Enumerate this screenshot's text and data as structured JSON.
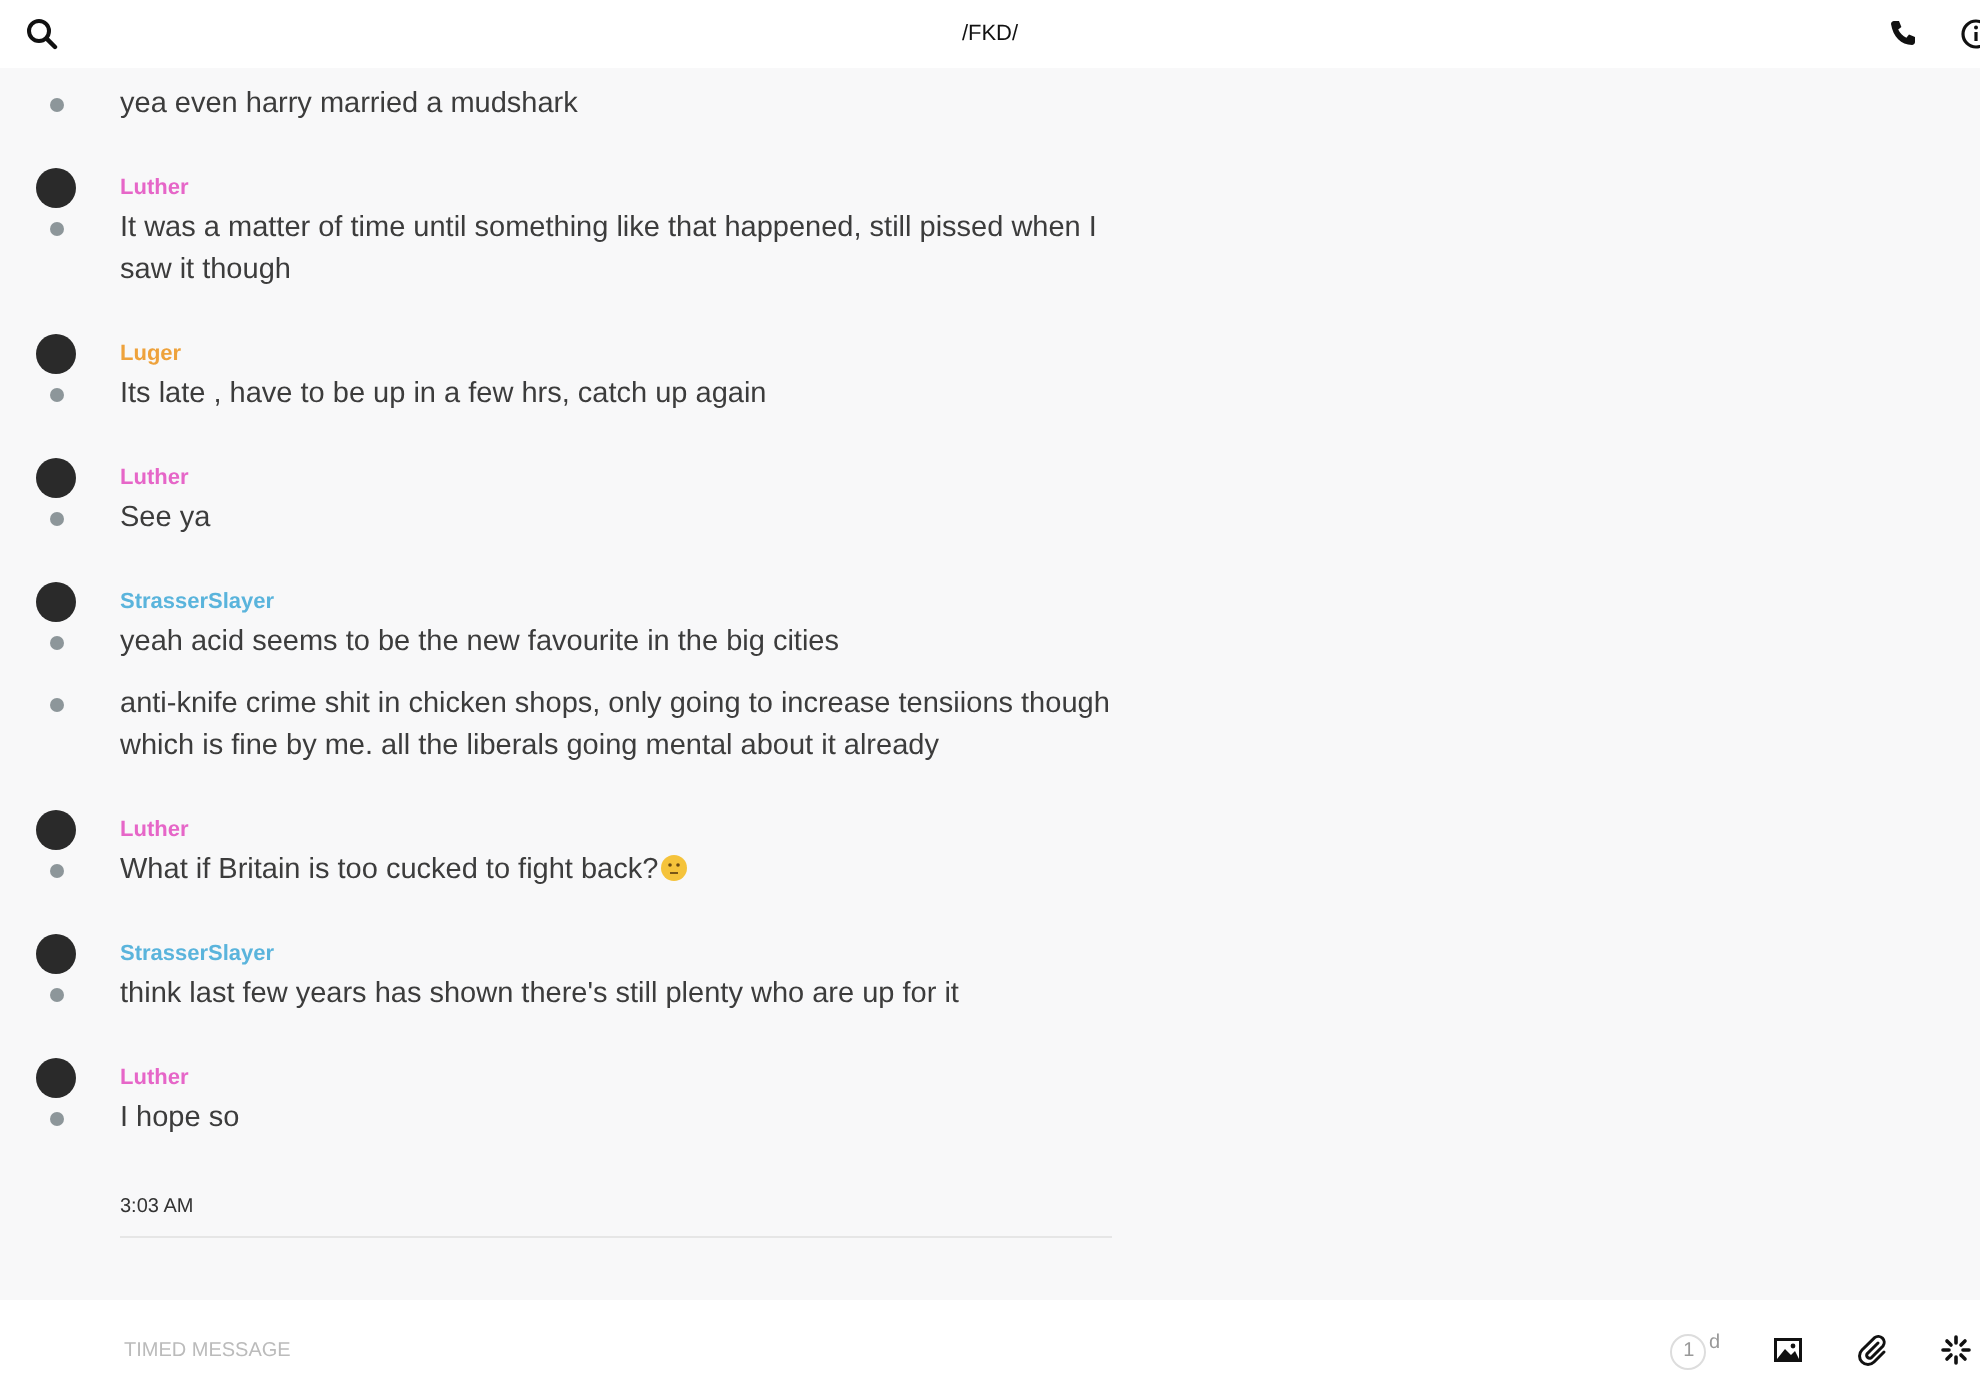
{
  "header": {
    "title": "/FKD/"
  },
  "groups": [
    {
      "messages": [
        {
          "text": "yea even harry married a mudshark",
          "emoji": false
        }
      ]
    },
    {
      "author": "Luther",
      "color": "#e666c8",
      "messages": [
        {
          "text": "It was a matter of time until something like that happened, still pissed when I saw it though",
          "emoji": false
        }
      ]
    },
    {
      "author": "Luger",
      "color": "#eea23c",
      "messages": [
        {
          "text": "Its late , have to be up in a few hrs, catch up again",
          "emoji": false
        }
      ]
    },
    {
      "author": "Luther",
      "color": "#e666c8",
      "messages": [
        {
          "text": "See ya",
          "emoji": false
        }
      ]
    },
    {
      "author": "StrasserSlayer",
      "color": "#5ab4dc",
      "messages": [
        {
          "text": "yeah acid seems to be the new favourite in the big cities",
          "emoji": false
        },
        {
          "text": "anti-knife crime shit in chicken shops, only going to increase tensiions though which is fine by me. all the liberals going mental about it already",
          "emoji": false
        }
      ]
    },
    {
      "author": "Luther",
      "color": "#e666c8",
      "messages": [
        {
          "text": "What if Britain is too cucked to fight back?",
          "emoji": true
        }
      ]
    },
    {
      "author": "StrasserSlayer",
      "color": "#5ab4dc",
      "messages": [
        {
          "text": "think last few years has shown there's still plenty who are up for it",
          "emoji": false
        }
      ]
    },
    {
      "author": "Luther",
      "color": "#e666c8",
      "messages": [
        {
          "text": "I hope so",
          "emoji": false
        }
      ]
    }
  ],
  "timestamp": "3:03 AM",
  "composer": {
    "placeholder": "TIMED MESSAGE",
    "timer_count": "1",
    "timer_unit": "d"
  }
}
